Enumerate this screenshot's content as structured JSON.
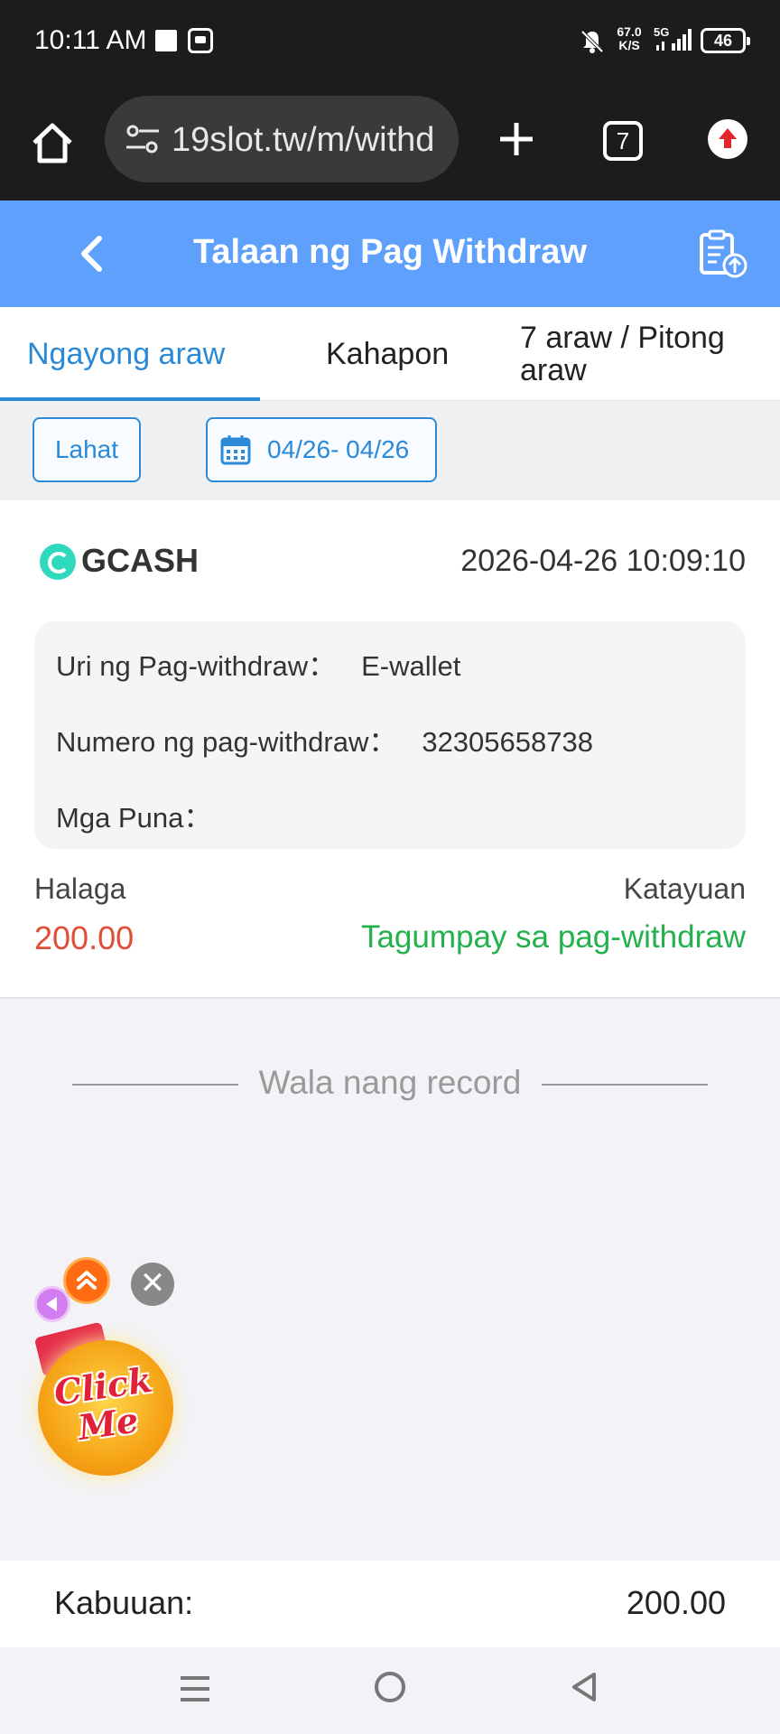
{
  "status_bar": {
    "time": "10:11 AM",
    "speed_value": "67.0",
    "speed_unit": "K/S",
    "network": "5G",
    "battery": "46"
  },
  "browser": {
    "url": "19slot.tw/m/withd",
    "tab_count": "7"
  },
  "header": {
    "title": "Talaan ng Pag Withdraw"
  },
  "tabs": [
    {
      "label": "Ngayong araw",
      "active": true
    },
    {
      "label": "Kahapon",
      "active": false
    },
    {
      "label": "7 araw / Pitong araw",
      "active": false
    }
  ],
  "filters": {
    "all_label": "Lahat",
    "date_range": "04/26- 04/26"
  },
  "record": {
    "provider": "GCASH",
    "datetime": "2026-04-26 10:09:10",
    "type_label": "Uri ng Pag-withdraw：",
    "type_value": "E-wallet",
    "number_label": "Numero ng pag-withdraw：",
    "number_value": "32305658738",
    "remarks_label": "Mga Puna：",
    "remarks_value": "",
    "amount_label": "Halaga",
    "amount_value": "200.00",
    "status_label": "Katayuan",
    "status_value": "Tagumpay sa pag-withdraw"
  },
  "no_more_text": "Wala nang record",
  "floating": {
    "click_me_line1": "Click",
    "click_me_line2": "Me",
    "close_symbol": "✕"
  },
  "total": {
    "label": "Kabuuan:",
    "value": "200.00"
  },
  "colors": {
    "header_blue": "#5ea0fc",
    "active_tab": "#2a8ad8",
    "amount_red": "#e04e36",
    "success_green": "#22b14c"
  }
}
